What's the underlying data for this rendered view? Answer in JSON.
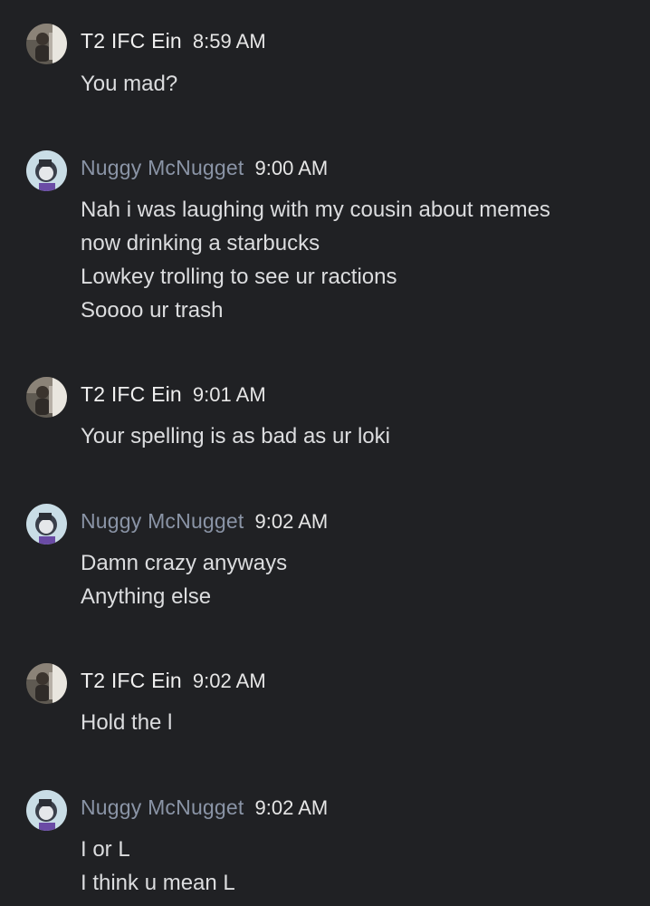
{
  "messages": [
    {
      "author": "T2 IFC Ein",
      "time": "8:59 AM",
      "avatar": "photo-avatar",
      "lines": [
        "You mad?"
      ]
    },
    {
      "author": "Nuggy McNugget",
      "time": "9:00 AM",
      "avatar": "cartoon-avatar",
      "lines": [
        "Nah i was laughing with my cousin about memes",
        "now drinking a starbucks",
        "Lowkey trolling to see ur ractions",
        "Soooo ur trash"
      ]
    },
    {
      "author": "T2 IFC Ein",
      "time": "9:01 AM",
      "avatar": "photo-avatar",
      "lines": [
        "Your spelling is as bad as ur loki"
      ]
    },
    {
      "author": "Nuggy McNugget",
      "time": "9:02 AM",
      "avatar": "cartoon-avatar",
      "lines": [
        "Damn crazy anyways",
        "Anything else"
      ]
    },
    {
      "author": "T2 IFC Ein",
      "time": "9:02 AM",
      "avatar": "photo-avatar",
      "lines": [
        "Hold the l"
      ]
    },
    {
      "author": "Nuggy McNugget",
      "time": "9:02 AM",
      "avatar": "cartoon-avatar",
      "lines": [
        "I or L",
        "I think u mean L"
      ]
    }
  ],
  "colors": {
    "background": "#202124",
    "author_default": "#f0f0f0",
    "author_nuggy": "#8a94a6",
    "text": "#dcdddf"
  }
}
